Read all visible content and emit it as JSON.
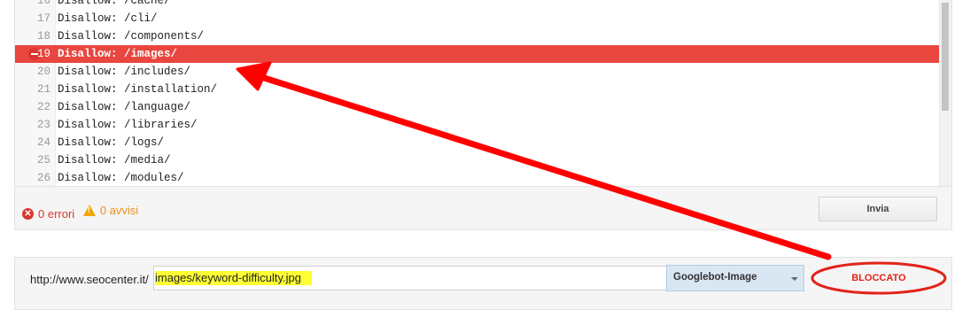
{
  "editor": {
    "lines": [
      {
        "num": "16",
        "text": "Disallow: /cache/",
        "blocked": false
      },
      {
        "num": "17",
        "text": "Disallow: /cli/",
        "blocked": false
      },
      {
        "num": "18",
        "text": "Disallow: /components/",
        "blocked": false
      },
      {
        "num": "19",
        "text": "Disallow: /images/",
        "blocked": true
      },
      {
        "num": "20",
        "text": "Disallow: /includes/",
        "blocked": false
      },
      {
        "num": "21",
        "text": "Disallow: /installation/",
        "blocked": false
      },
      {
        "num": "22",
        "text": "Disallow: /language/",
        "blocked": false
      },
      {
        "num": "23",
        "text": "Disallow: /libraries/",
        "blocked": false
      },
      {
        "num": "24",
        "text": "Disallow: /logs/",
        "blocked": false
      },
      {
        "num": "25",
        "text": "Disallow: /media/",
        "blocked": false
      },
      {
        "num": "26",
        "text": "Disallow: /modules/",
        "blocked": false
      }
    ]
  },
  "status": {
    "errors": "0 errori",
    "warnings": "0 avvisi"
  },
  "actions": {
    "send_label": "Invia"
  },
  "test": {
    "url_prefix": "http://www.seocenter.it/",
    "url_value": "images/keyword-difficulty.jpg",
    "user_agent": "Googlebot-Image",
    "result": "BLOCCATO"
  },
  "colors": {
    "blocked_line": "#e8463f",
    "annotation": "#ff0000",
    "highlight": "#ffff33",
    "select_bg": "#d9e7f3"
  }
}
